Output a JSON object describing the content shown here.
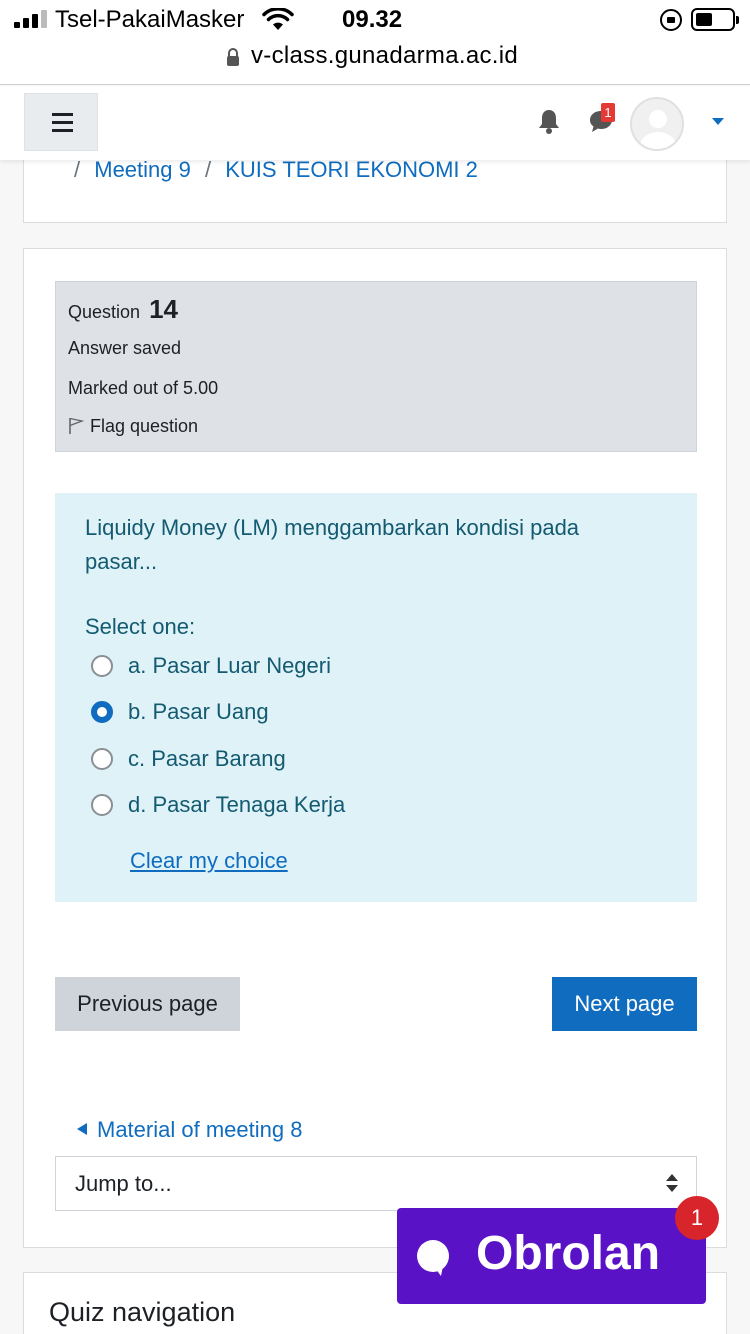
{
  "status_bar": {
    "carrier": "Tsel-PakaiMasker",
    "time": "09.32",
    "battery_percent": 40
  },
  "browser": {
    "url": "v-class.gunadarma.ac.id"
  },
  "navbar": {
    "notification_count": "1"
  },
  "breadcrumb": {
    "sep": "/",
    "items": [
      "Meeting 9",
      "KUIS TEORI EKONOMI 2"
    ]
  },
  "question_info": {
    "label": "Question",
    "number": "14",
    "state": "Answer saved",
    "grade": "Marked out of 5.00",
    "flag": "Flag question"
  },
  "question": {
    "text": "Liquidy Money (LM) menggambarkan kondisi pada pasar...",
    "prompt": "Select one:",
    "options": [
      {
        "label": "a. Pasar Luar Negeri",
        "selected": false
      },
      {
        "label": "b. Pasar Uang",
        "selected": true
      },
      {
        "label": "c. Pasar Barang",
        "selected": false
      },
      {
        "label": "d. Pasar Tenaga Kerja",
        "selected": false
      }
    ],
    "clear": "Clear my choice"
  },
  "buttons": {
    "previous": "Previous page",
    "next": "Next page"
  },
  "activity_nav": {
    "previous": "Material of meeting 8",
    "jump": "Jump to..."
  },
  "quiz_nav": {
    "title": "Quiz navigation"
  },
  "chat_widget": {
    "label": "Obrolan",
    "badge": "1",
    "color": "#5a12c7"
  },
  "colors": {
    "link": "#0f6cbf",
    "question_bg": "#def2f8",
    "info_bg": "#dee2e6"
  }
}
